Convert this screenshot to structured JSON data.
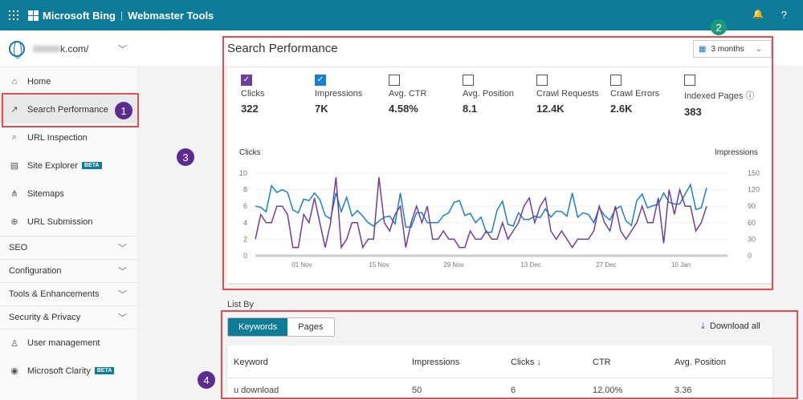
{
  "header": {
    "brand": "Microsoft Bing",
    "product": "Webmaster Tools",
    "icons": [
      "app-launcher-icon",
      "bell-icon",
      "help-icon"
    ],
    "help": "?",
    "bell": "🔔"
  },
  "sidebar": {
    "site": "k.com/",
    "items": [
      {
        "label": "Home",
        "icon": "home-icon",
        "glyph": "⌂"
      },
      {
        "label": "Search Performance",
        "icon": "trend-icon",
        "glyph": "↗",
        "active": true
      },
      {
        "label": "URL Inspection",
        "icon": "search-icon",
        "glyph": "⌕"
      },
      {
        "label": "Site Explorer",
        "icon": "document-icon",
        "glyph": "▤",
        "badge": "BETA"
      },
      {
        "label": "Sitemaps",
        "icon": "sitemap-icon",
        "glyph": "⋔"
      },
      {
        "label": "URL Submission",
        "icon": "globe-icon",
        "glyph": "⊕"
      }
    ],
    "groups": [
      "SEO",
      "Configuration",
      "Tools & Enhancements",
      "Security & Privacy"
    ],
    "bottom": [
      {
        "label": "User management",
        "icon": "user-icon",
        "glyph": "♙"
      },
      {
        "label": "Microsoft Clarity",
        "icon": "clarity-icon",
        "glyph": "◉",
        "badge": "BETA"
      }
    ]
  },
  "main": {
    "title": "Search Performance",
    "range": "3 months",
    "metrics": [
      {
        "label": "Clicks",
        "value": "322",
        "checked": true,
        "color": "#6b3fa0"
      },
      {
        "label": "Impressions",
        "value": "7K",
        "checked": true,
        "color": "#1a7fd4"
      },
      {
        "label": "Avg. CTR",
        "value": "4.58%",
        "checked": false
      },
      {
        "label": "Avg. Position",
        "value": "8.1",
        "checked": false
      },
      {
        "label": "Crawl Requests",
        "value": "12.4K",
        "checked": false
      },
      {
        "label": "Crawl Errors",
        "value": "2.6K",
        "checked": false
      },
      {
        "label": "Indexed Pages",
        "value": "383",
        "checked": false,
        "info": "ⓘ"
      }
    ],
    "list_by": "List By",
    "tabs": [
      "Keywords",
      "Pages"
    ],
    "download": "Download all",
    "table": {
      "headers": [
        "Keyword",
        "Impressions",
        "Clicks ↓",
        "CTR",
        "Avg. Position"
      ],
      "rows": [
        [
          "u download",
          "50",
          "6",
          "12.00%",
          "3.36"
        ]
      ]
    }
  },
  "annotations": [
    "1",
    "2",
    "3",
    "4"
  ],
  "chart_data": {
    "type": "line",
    "ylabel": "Clicks",
    "y2label": "Impressions",
    "ylim": [
      0,
      10
    ],
    "y2lim": [
      0,
      150
    ],
    "yticks": [
      "0",
      "2",
      "4",
      "6",
      "8",
      "10"
    ],
    "y2ticks": [
      "0",
      "30",
      "60",
      "90",
      "120",
      "150"
    ],
    "xticks": [
      "01 Nov",
      "15 Nov",
      "29 Nov",
      "13 Dec",
      "27 Dec",
      "10 Jan"
    ],
    "x_first": "23 Oct",
    "x_last": "15 Jan",
    "grid": true,
    "legend": "none",
    "series": [
      {
        "name": "Clicks",
        "axis": "left",
        "color": "#6b3fa0",
        "values": [
          2,
          5,
          4,
          4,
          6,
          6,
          5,
          1,
          1,
          5,
          4,
          7,
          4,
          1,
          4,
          9.5,
          1,
          2,
          4,
          4,
          1,
          2,
          2,
          9.5,
          4,
          3,
          5,
          6,
          1,
          4,
          6,
          4,
          6,
          2,
          2,
          3,
          2,
          2,
          1,
          1,
          3,
          2,
          2,
          3,
          2,
          2,
          4,
          2,
          3,
          4,
          6,
          7,
          4,
          6,
          7,
          3,
          2,
          3,
          2,
          1,
          2,
          2,
          2,
          3,
          6,
          4,
          3,
          6,
          3,
          2,
          3,
          4,
          6,
          4,
          4,
          7,
          1.5,
          8,
          5,
          8,
          6,
          6,
          3,
          4,
          6
        ]
      },
      {
        "name": "Impressions",
        "axis": "right",
        "color": "#1a7fd4",
        "values": [
          90,
          88,
          80,
          127,
          115,
          120,
          115,
          83,
          78,
          103,
          100,
          114,
          102,
          73,
          67,
          114,
          80,
          106,
          72,
          82,
          72,
          60,
          54,
          63,
          70,
          72,
          58,
          114,
          52,
          52,
          78,
          78,
          60,
          60,
          60,
          73,
          78,
          97,
          100,
          73,
          77,
          60,
          70,
          42,
          43,
          83,
          99,
          57,
          54,
          78,
          66,
          66,
          72,
          69,
          85,
          70,
          81,
          80,
          72,
          114,
          70,
          78,
          75,
          60,
          87,
          73,
          65,
          84,
          90,
          63,
          55,
          100,
          112,
          87,
          91,
          93,
          114,
          97,
          94,
          94,
          112,
          129,
          84,
          87,
          123
        ]
      }
    ]
  }
}
